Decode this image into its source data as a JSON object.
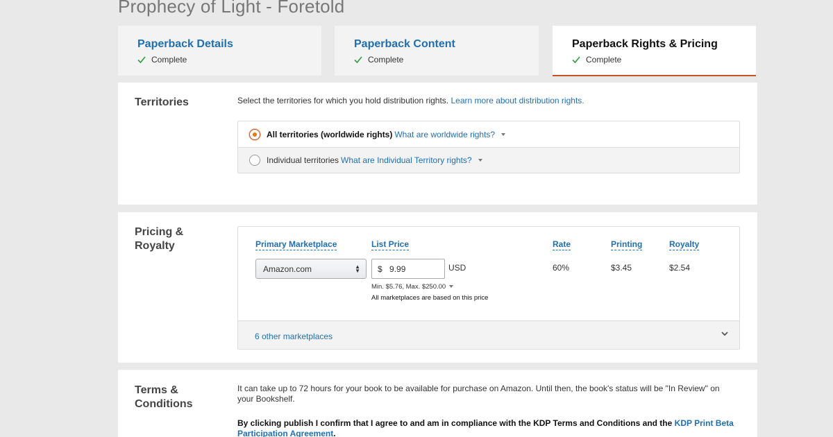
{
  "page_title": "Prophecy of Light - Foretold",
  "tabs": [
    {
      "label": "Paperback Details",
      "status": "Complete"
    },
    {
      "label": "Paperback Content",
      "status": "Complete"
    },
    {
      "label": "Paperback Rights & Pricing",
      "status": "Complete"
    }
  ],
  "colors": {
    "link": "#1f6fb2",
    "accent": "#c7511f",
    "radio_fill": "#e47911",
    "check": "#2e9e3e"
  },
  "territories": {
    "label": "Territories",
    "lead_text": "Select the territories for which you hold distribution rights.",
    "lead_link": "Learn more about distribution rights.",
    "options": [
      {
        "label": "All territories (worldwide rights)",
        "help": "What are worldwide rights?",
        "selected": true
      },
      {
        "label": "Individual territories",
        "help": "What are Individual Territory rights?",
        "selected": false
      }
    ]
  },
  "pricing": {
    "label_line1": "Pricing &",
    "label_line2": "Royalty",
    "headers": {
      "marketplace": "Primary Marketplace",
      "list_price": "List Price",
      "rate": "Rate",
      "printing": "Printing",
      "royalty": "Royalty"
    },
    "marketplace_value": "Amazon.com",
    "currency_symbol": "$",
    "price_value": "9.99",
    "currency": "USD",
    "min_max": "Min. $5.76, Max. $250.00",
    "note": "All marketplaces are based on this price",
    "rate": "60%",
    "printing": "$3.45",
    "royalty": "$2.54",
    "other_marketplaces": "6 other marketplaces"
  },
  "terms": {
    "label_line1": "Terms &",
    "label_line2": "Conditions",
    "text": "It can take up to 72 hours for your book to be available for purchase on Amazon. Until then, the book's status will be \"In Review\" on your Bookshelf.",
    "confirm_text": "By clicking publish I confirm that I agree to and am in compliance with the KDP Terms and Conditions and the",
    "confirm_link": "KDP Print Beta Participation Agreement",
    "confirm_end": "."
  }
}
